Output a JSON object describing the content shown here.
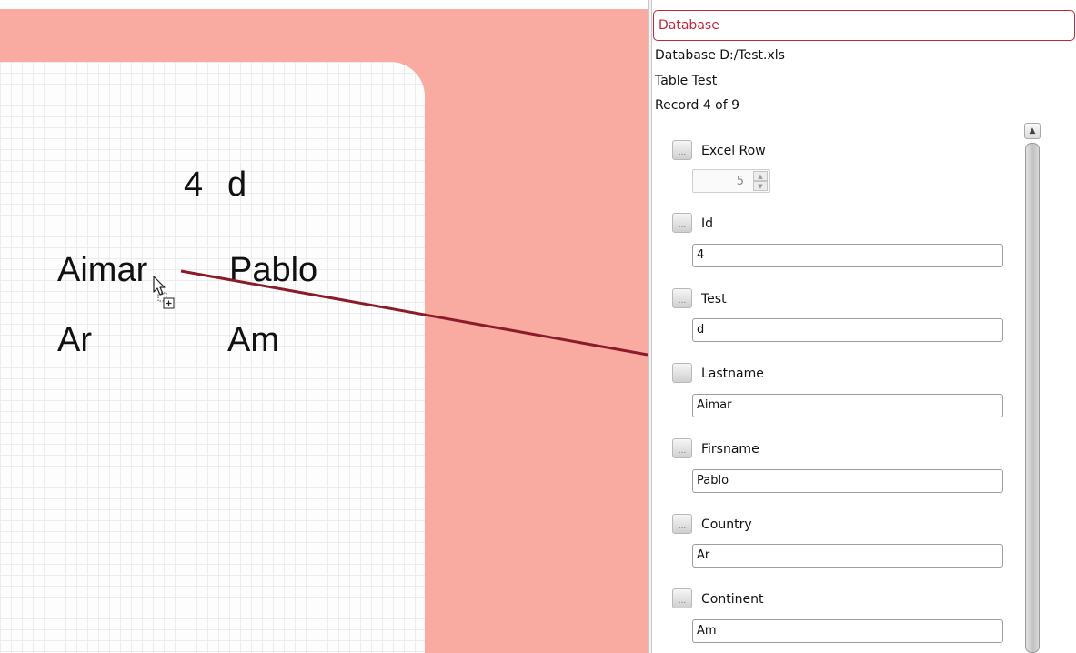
{
  "canvas": {
    "id_value": "4",
    "test_value": "d",
    "lastname_value": "Aimar",
    "firstname_value": "Pablo",
    "country_value": "Ar",
    "continent_value": "Am",
    "colors": {
      "page": "#f9aba1",
      "card": "#fdfdfd",
      "link_line": "#8b1a2b"
    }
  },
  "panel": {
    "header_title": "Database",
    "database_line": "Database D:/Test.xls",
    "table_line": "Table Test",
    "record_line": "Record 4 of 9",
    "accent_color": "#c0283a",
    "fields": [
      {
        "button_label": "...",
        "label": "Excel Row",
        "value": "5",
        "kind": "spinner"
      },
      {
        "button_label": "...",
        "label": "Id",
        "value": "4",
        "kind": "text"
      },
      {
        "button_label": "...",
        "label": "Test",
        "value": "d",
        "kind": "text"
      },
      {
        "button_label": "...",
        "label": "Lastname",
        "value": "Aimar",
        "kind": "text"
      },
      {
        "button_label": "...",
        "label": "Firsname",
        "value": "Pablo",
        "kind": "text"
      },
      {
        "button_label": "...",
        "label": "Country",
        "value": "Ar",
        "kind": "text"
      },
      {
        "button_label": "...",
        "label": "Continent",
        "value": "Am",
        "kind": "text"
      }
    ]
  },
  "icons": {
    "cursor": "drag-copy-cursor-icon",
    "spin_up": "triangle-up-icon",
    "spin_down": "triangle-down-icon",
    "scroll_up": "scroll-up-arrow-icon"
  }
}
